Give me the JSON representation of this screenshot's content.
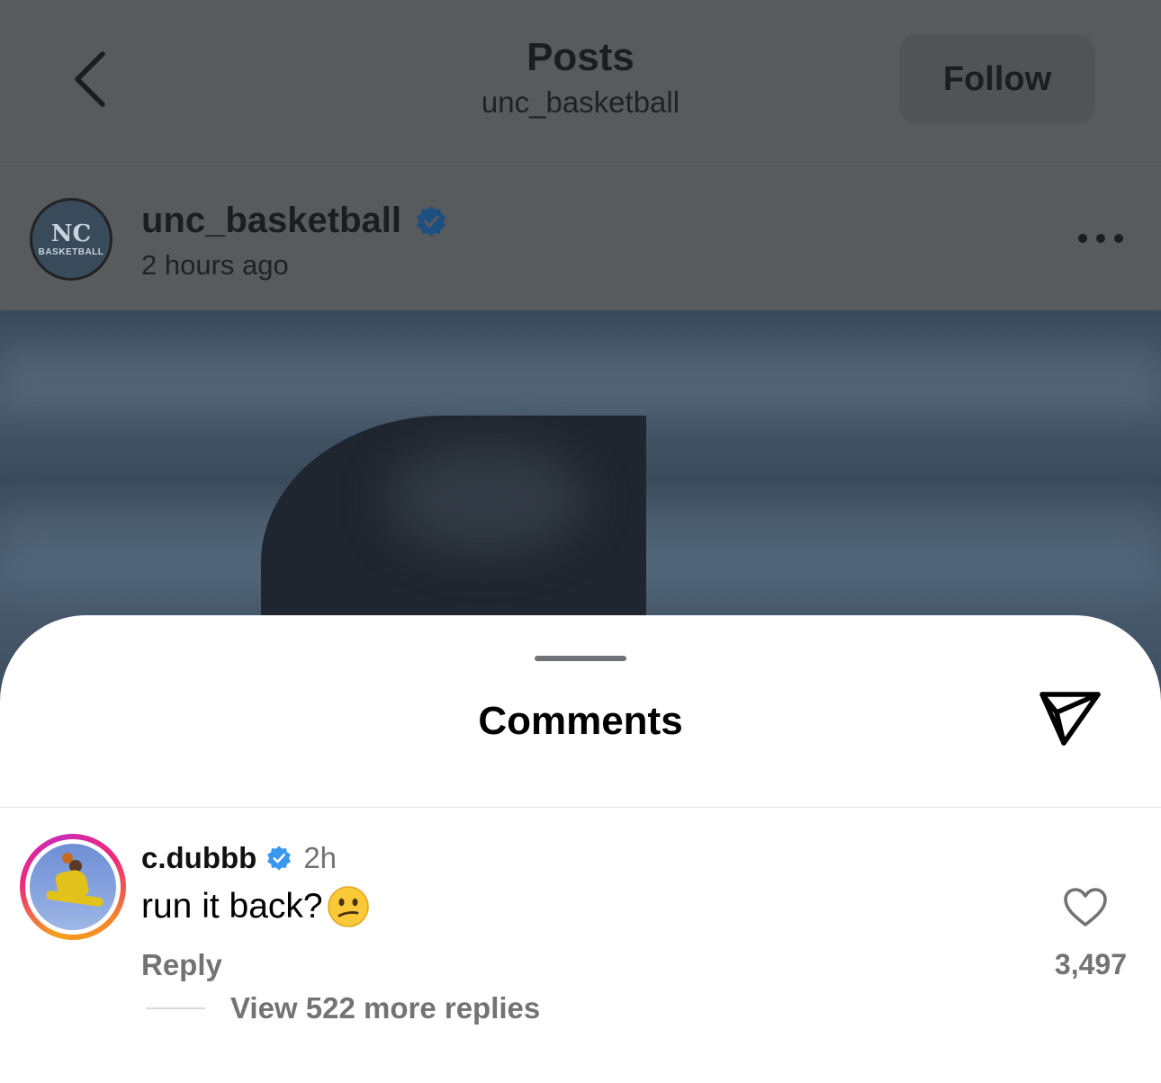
{
  "header": {
    "title": "Posts",
    "subtitle": "unc_basketball",
    "follow_label": "Follow",
    "back_icon": "chevron-left-icon"
  },
  "post": {
    "username": "unc_basketball",
    "time": "2 hours ago",
    "avatar_text": "NC",
    "avatar_sub": "BASKETBALL",
    "verified": true,
    "more_icon": "more-horizontal-icon"
  },
  "comments_sheet": {
    "title": "Comments",
    "share_icon": "send-icon",
    "comments": [
      {
        "username": "c.dubbb",
        "verified": true,
        "time": "2h",
        "text": "run it back?",
        "emoji": "confused-face",
        "reply_label": "Reply",
        "like_count": "3,497",
        "view_replies": "View 522 more replies"
      }
    ]
  },
  "colors": {
    "verified_blue": "#3897f0",
    "muted_text": "#737373",
    "dim_overlay": "#585b5e"
  }
}
